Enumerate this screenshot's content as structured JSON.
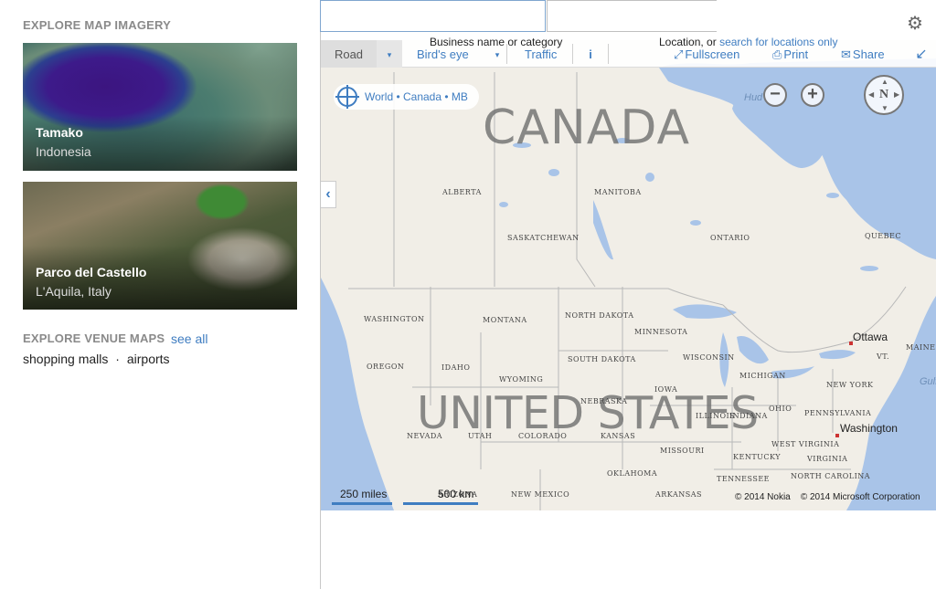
{
  "left": {
    "imagery_heading": "EXPLORE MAP IMAGERY",
    "tiles": [
      {
        "title": "Tamako",
        "subtitle": "Indonesia"
      },
      {
        "title": "Parco del Castello",
        "subtitle": "L'Aquila, Italy"
      }
    ],
    "venue_heading": "EXPLORE VENUE MAPS",
    "see_all": "see all",
    "venue_links": [
      "shopping malls",
      "airports"
    ],
    "venue_sep": "·"
  },
  "search": {
    "what_placeholder": "Business name or category",
    "where_placeholder": "Location, or",
    "where_link": "search for locations only"
  },
  "icons": {
    "gear": "gear-icon",
    "locate": "locate-icon",
    "fullscreen": "fullscreen-icon",
    "print": "print-icon",
    "share": "share-icon",
    "collapse": "collapse-icon",
    "info": "info-icon",
    "compass": "compass-icon"
  },
  "toolbar": {
    "road": "Road",
    "birds_eye": "Bird's eye",
    "traffic": "Traffic",
    "info": "i",
    "fullscreen": "Fullscreen",
    "print": "Print",
    "share": "Share",
    "dropdown": "▾"
  },
  "map": {
    "breadcrumb": "World • Canada • MB",
    "zoom_out": "−",
    "zoom_in": "+",
    "compass_label": "N",
    "collapse_arrow": "‹",
    "countries": [
      "CANADA",
      "UNITED STATES"
    ],
    "states": [
      "ALBERTA",
      "MANITOBA",
      "SASKATCHEWAN",
      "ONTARIO",
      "QUEBEC",
      "WASHINGTON",
      "MONTANA",
      "NORTH DAKOTA",
      "MINNESOTA",
      "OREGON",
      "IDAHO",
      "SOUTH DAKOTA",
      "WISCONSIN",
      "MICHIGAN",
      "WYOMING",
      "IOWA",
      "NEBRASKA",
      "ILLINOIS",
      "INDIANA",
      "OHIO",
      "PENNSYLVANIA",
      "NEVADA",
      "UTAH",
      "COLORADO",
      "KANSAS",
      "MISSOURI",
      "WEST VIRGINIA",
      "VIRGINIA",
      "KENTUCKY",
      "OKLAHOMA",
      "TENNESSEE",
      "NORTH CAROLINA",
      "ARIZONA",
      "NEW MEXICO",
      "ARKANSAS",
      "NEW YORK",
      "VT.",
      "MAINE"
    ],
    "cities": [
      "Ottawa",
      "Washington"
    ],
    "water": [
      "Hud",
      "Gulf"
    ],
    "scale_miles": "250 miles",
    "scale_km": "500 km",
    "copyright": "© 2014 Nokia    © 2014 Microsoft Corporation"
  },
  "colors": {
    "accent": "#3f7dc1",
    "water": "#a9c4e8",
    "land": "#f1eee7"
  }
}
